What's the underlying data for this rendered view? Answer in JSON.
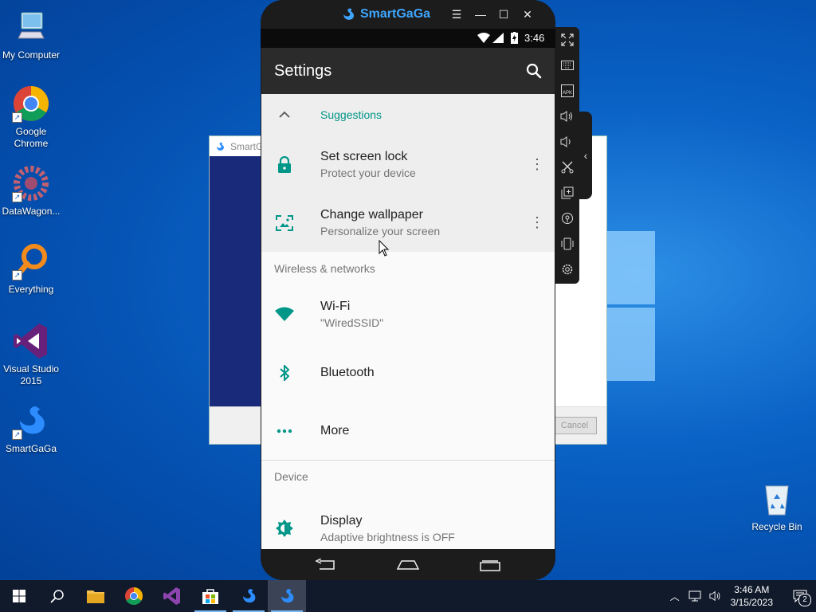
{
  "desktop": {
    "icons": [
      {
        "label": "My Computer"
      },
      {
        "label": "Google Chrome"
      },
      {
        "label": "DataWagon..."
      },
      {
        "label": "Everything"
      },
      {
        "label": "Visual Studio 2015"
      },
      {
        "label": "SmartGaGa"
      }
    ],
    "recycle_bin": "Recycle Bin"
  },
  "bg_dialog": {
    "title": "SmartG",
    "cancel": "Cancel"
  },
  "emulator": {
    "brand": "SmartGaGa",
    "status_time": "3:46",
    "settings_title": "Settings",
    "suggestions_header": "Suggestions",
    "suggestions": [
      {
        "title": "Set screen lock",
        "subtitle": "Protect your device"
      },
      {
        "title": "Change wallpaper",
        "subtitle": "Personalize your screen"
      }
    ],
    "sections": [
      {
        "header": "Wireless & networks",
        "items": [
          {
            "title": "Wi-Fi",
            "subtitle": "\"WiredSSID\""
          },
          {
            "title": "Bluetooth",
            "subtitle": ""
          },
          {
            "title": "More",
            "subtitle": ""
          }
        ]
      },
      {
        "header": "Device",
        "items": [
          {
            "title": "Display",
            "subtitle": "Adaptive brightness is OFF"
          }
        ]
      }
    ],
    "accent_color": "#009688"
  },
  "taskbar": {
    "time": "3:46 AM",
    "date": "3/15/2023",
    "notification_count": "2"
  }
}
